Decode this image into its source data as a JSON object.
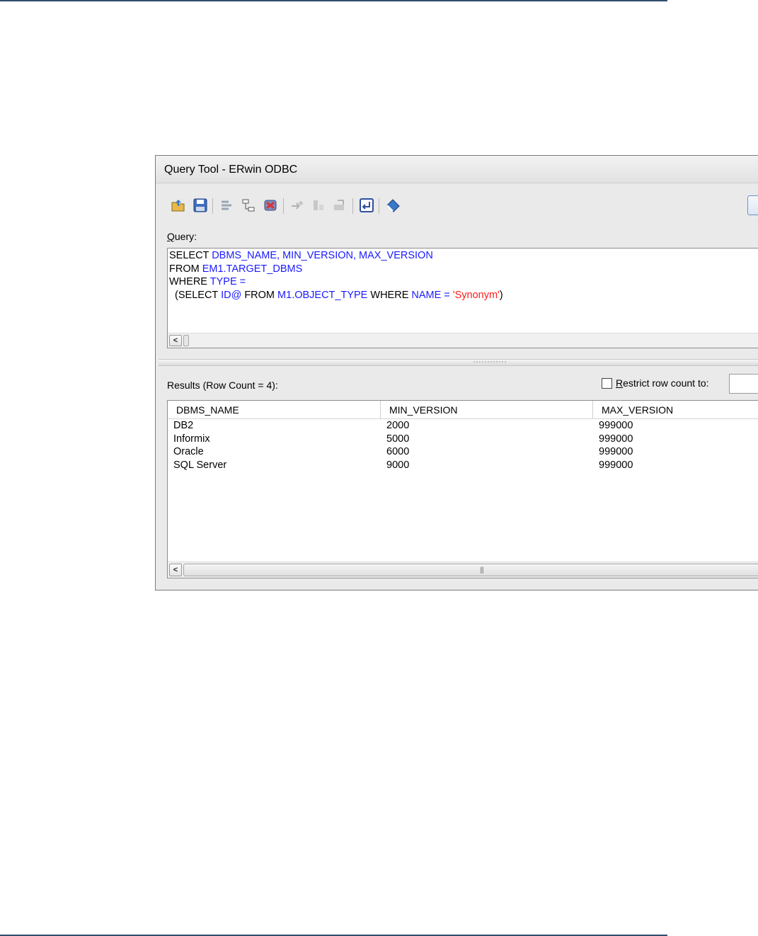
{
  "window": {
    "title": "Query Tool - ERwin ODBC"
  },
  "toolbar": {
    "icons": [
      "open-icon",
      "save-icon",
      "connect-icon",
      "schema-icon",
      "disconnect-icon",
      "execute-icon",
      "commit-icon",
      "rollback-icon",
      "newline-icon",
      "clear-icon"
    ]
  },
  "query": {
    "label_access_key": "Q",
    "label_rest": "uery:",
    "lines": [
      [
        {
          "t": "SELECT ",
          "c": "kw"
        },
        {
          "t": "DBMS_NAME, MIN_VERSION, MAX_VERSION",
          "c": "id"
        }
      ],
      [
        {
          "t": "FROM ",
          "c": "kw"
        },
        {
          "t": "EM1.TARGET_DBMS",
          "c": "id"
        }
      ],
      [
        {
          "t": "WHERE ",
          "c": "kw"
        },
        {
          "t": "TYPE =",
          "c": "id"
        }
      ],
      [
        {
          "t": "  (SELECT ",
          "c": "kw"
        },
        {
          "t": "ID@",
          "c": "id"
        },
        {
          "t": " FROM ",
          "c": "kw"
        },
        {
          "t": "M1.OBJECT_TYPE",
          "c": "id"
        },
        {
          "t": " WHERE ",
          "c": "kw"
        },
        {
          "t": "NAME = ",
          "c": "id"
        },
        {
          "t": "'Synonym'",
          "c": "str"
        },
        {
          "t": ")",
          "c": "kw"
        }
      ]
    ]
  },
  "results": {
    "label": "Results (Row Count = 4):",
    "restrict_access_key": "R",
    "restrict_rest": "estrict row count to:",
    "restrict_checked": false,
    "restrict_value": "",
    "columns": [
      "DBMS_NAME",
      "MIN_VERSION",
      "MAX_VERSION"
    ],
    "rows": [
      [
        "DB2",
        "2000",
        "999000"
      ],
      [
        "Informix",
        "5000",
        "999000"
      ],
      [
        "Oracle",
        "6000",
        "999000"
      ],
      [
        "SQL Server",
        "9000",
        "999000"
      ]
    ]
  }
}
